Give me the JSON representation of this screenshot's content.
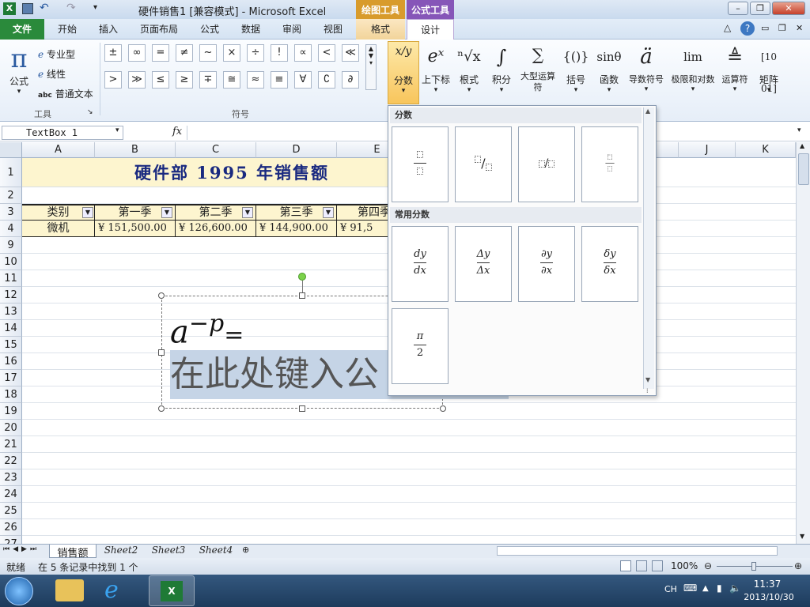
{
  "window": {
    "title": "硬件销售1 [兼容模式] - Microsoft Excel",
    "context_tab_groups": [
      "绘图工具",
      "公式工具"
    ]
  },
  "tabs": [
    "文件",
    "开始",
    "插入",
    "页面布局",
    "公式",
    "数据",
    "审阅",
    "视图",
    "格式",
    "设计"
  ],
  "ribbon": {
    "tools_group": {
      "label": "工具",
      "equation_label": "公式",
      "options": [
        "专业型",
        "线性",
        "普通文本"
      ],
      "abc": "abc"
    },
    "symbols_group": {
      "label": "符号",
      "row1": [
        "±",
        "∞",
        "=",
        "≠",
        "~",
        "×",
        "÷",
        "!",
        "∝",
        "<",
        "≪"
      ],
      "row2": [
        ">",
        "≫",
        "≤",
        "≥",
        "∓",
        "≅",
        "≈",
        "≡",
        "∀",
        "∁",
        "∂"
      ]
    },
    "structures": [
      {
        "label": "分数",
        "glyph": "x/y"
      },
      {
        "label": "上下标",
        "glyph": "eˣ"
      },
      {
        "label": "根式",
        "glyph": "ⁿ√x"
      },
      {
        "label": "积分",
        "glyph": "∫"
      },
      {
        "label": "大型运算符",
        "glyph": "∑"
      },
      {
        "label": "括号",
        "glyph": "{()}"
      },
      {
        "label": "函数",
        "glyph": "sinθ"
      },
      {
        "label": "导数符号",
        "glyph": "ä"
      },
      {
        "label": "极限和对数",
        "glyph": "lim"
      },
      {
        "label": "运算符",
        "glyph": "≜"
      },
      {
        "label": "矩阵",
        "glyph": "[10 01]"
      }
    ]
  },
  "formula_bar": {
    "name_box": "TextBox 1",
    "fx": "fx",
    "value": ""
  },
  "columns": [
    "A",
    "B",
    "C",
    "D",
    "E",
    "J",
    "K"
  ],
  "rows": [
    "1",
    "2",
    "3",
    "4",
    "9",
    "10",
    "11",
    "12",
    "13",
    "14",
    "15",
    "16",
    "17",
    "18",
    "19",
    "20",
    "21",
    "22",
    "23",
    "24",
    "25",
    "26",
    "27"
  ],
  "sheet": {
    "title": "硬件部 1995 年销售额",
    "headers": [
      "类别",
      "第一季",
      "第二季",
      "第三季",
      "第四季"
    ],
    "row4": [
      "微机",
      "¥ 151,500.00",
      "¥ 126,600.00",
      "¥ 144,900.00",
      "¥ 91,5"
    ]
  },
  "equation": {
    "lhs": "a",
    "sup": "−p",
    "eq": "=",
    "placeholder": "在此处键入公"
  },
  "gallery": {
    "section1": "分数",
    "section2": "常用分数",
    "common": [
      {
        "num": "dy",
        "den": "dx"
      },
      {
        "num": "Δy",
        "den": "Δx"
      },
      {
        "num": "∂y",
        "den": "∂x"
      },
      {
        "num": "δy",
        "den": "δx"
      },
      {
        "num": "π",
        "den": "2"
      }
    ]
  },
  "sheet_tabs": [
    "销售额",
    "Sheet2",
    "Sheet3",
    "Sheet4"
  ],
  "status": {
    "ready": "就绪",
    "message": "在 5 条记录中找到 1 个",
    "zoom": "100%"
  },
  "taskbar": {
    "lang": "CH",
    "time": "11:37",
    "date": "2013/10/30"
  }
}
